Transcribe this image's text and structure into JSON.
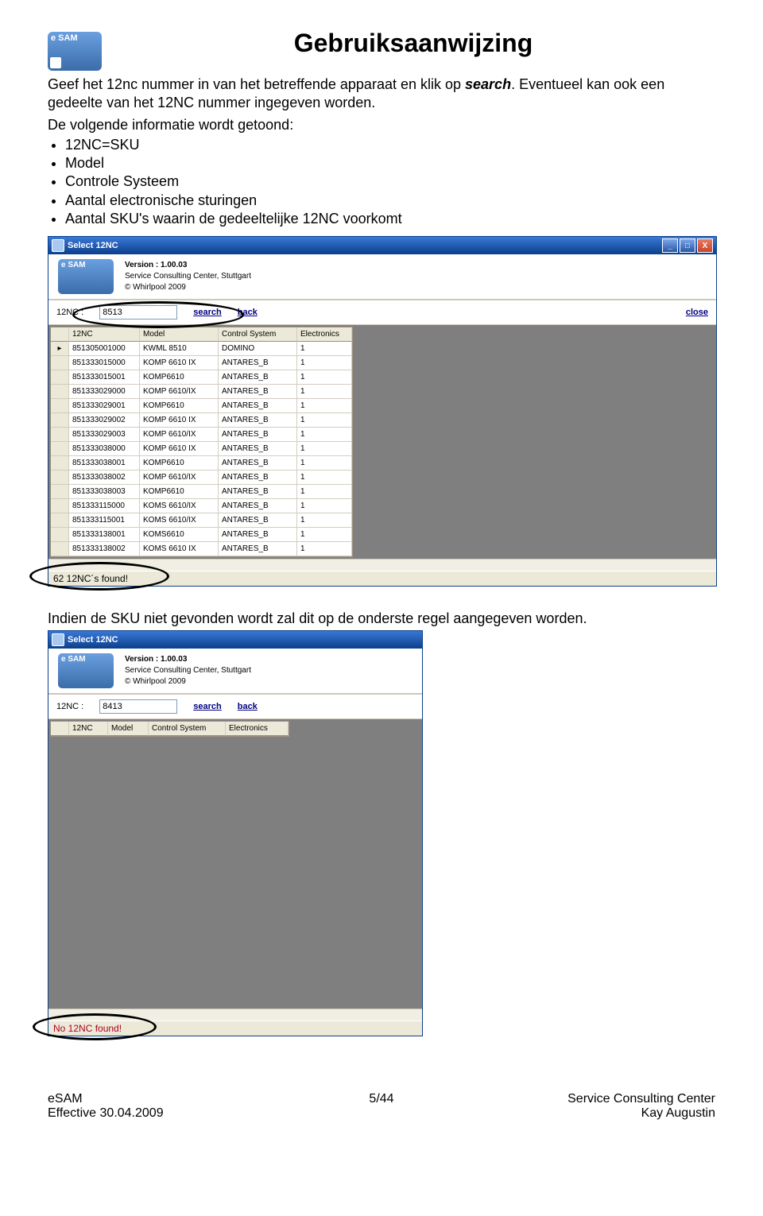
{
  "doc": {
    "title": "Gebruiksaanwijzing",
    "logo_text": "e SAM",
    "intro1a": "Geef het 12nc nummer in van het betreffende apparaat en klik op ",
    "intro1b": "search",
    "intro1c": ". Eventueel kan ook een gedeelte van het 12NC nummer ingegeven worden.",
    "intro2": "De volgende informatie wordt getoond:",
    "bullets": {
      "b1": "12NC=SKU",
      "b2": "Model",
      "b3": "Controle Systeem",
      "b4": "Aantal electronische sturingen",
      "b5": "Aantal SKU's waarin de gedeeltelijke 12NC voorkomt"
    },
    "mid": "Indien de SKU niet gevonden wordt zal dit op de onderste regel aangegeven worden."
  },
  "app": {
    "window_title": "Select 12NC",
    "logo_text": "e SAM",
    "version_label": "Version :",
    "version_value": "1.00.03",
    "center_label": "Service Consulting Center, Stuttgart",
    "copyright": "© Whirlpool 2009",
    "nc_label": "12NC :",
    "search_link": "search",
    "back_link": "back",
    "close_link": "close",
    "input1": "8513",
    "input2": "8413",
    "headers": {
      "nc": "12NC",
      "model": "Model",
      "sys": "Control System",
      "el": "Electronics"
    },
    "rows": [
      {
        "nc": "851305001000",
        "model": "KWML 8510",
        "sys": "DOMINO",
        "el": "1"
      },
      {
        "nc": "851333015000",
        "model": "KOMP 6610 IX",
        "sys": "ANTARES_B",
        "el": "1"
      },
      {
        "nc": "851333015001",
        "model": "KOMP6610",
        "sys": "ANTARES_B",
        "el": "1"
      },
      {
        "nc": "851333029000",
        "model": "KOMP 6610/IX",
        "sys": "ANTARES_B",
        "el": "1"
      },
      {
        "nc": "851333029001",
        "model": "KOMP6610",
        "sys": "ANTARES_B",
        "el": "1"
      },
      {
        "nc": "851333029002",
        "model": "KOMP 6610 IX",
        "sys": "ANTARES_B",
        "el": "1"
      },
      {
        "nc": "851333029003",
        "model": "KOMP 6610/IX",
        "sys": "ANTARES_B",
        "el": "1"
      },
      {
        "nc": "851333038000",
        "model": "KOMP 6610 IX",
        "sys": "ANTARES_B",
        "el": "1"
      },
      {
        "nc": "851333038001",
        "model": "KOMP6610",
        "sys": "ANTARES_B",
        "el": "1"
      },
      {
        "nc": "851333038002",
        "model": "KOMP 6610/IX",
        "sys": "ANTARES_B",
        "el": "1"
      },
      {
        "nc": "851333038003",
        "model": "KOMP6610",
        "sys": "ANTARES_B",
        "el": "1"
      },
      {
        "nc": "851333115000",
        "model": "KOMS 6610/IX",
        "sys": "ANTARES_B",
        "el": "1"
      },
      {
        "nc": "851333115001",
        "model": "KOMS 6610/IX",
        "sys": "ANTARES_B",
        "el": "1"
      },
      {
        "nc": "851333138001",
        "model": "KOMS6610",
        "sys": "ANTARES_B",
        "el": "1"
      },
      {
        "nc": "851333138002",
        "model": "KOMS 6610 IX",
        "sys": "ANTARES_B",
        "el": "1"
      }
    ],
    "status_found": "62 12NC´s found!",
    "status_none": "No 12NC found!"
  },
  "footer": {
    "left1": "eSAM",
    "left2": "Effective 30.04.2009",
    "center": "5/44",
    "right1": "Service Consulting Center",
    "right2": "Kay Augustin"
  }
}
